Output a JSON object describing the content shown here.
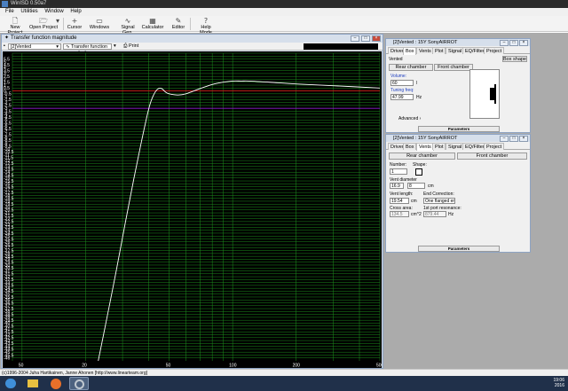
{
  "app": {
    "title": "WinISD 0.50a7"
  },
  "menu": [
    "File",
    "Utilities",
    "Window",
    "Help"
  ],
  "toolbar": {
    "new_project": "New Project",
    "open_project": "Open Project",
    "cursor": "Cursor",
    "windows": "Windows",
    "signal_gen": "Signal Gen.",
    "calculator": "Calculator",
    "editor": "Editor",
    "help_mode": "Help Mode"
  },
  "graph_window": {
    "title": "Transfer function magnitude",
    "project_select": "[2]Vented",
    "graph_select": "Transfer function magnitude",
    "print": "Print"
  },
  "chart_data": {
    "type": "line",
    "xscale": "log",
    "xlim": [
      9,
      500
    ],
    "ylim": [
      -46.5,
      6.5
    ],
    "x_ticks": [
      10,
      20,
      50,
      100,
      200,
      500
    ],
    "x_tick_labels": [
      "50",
      "20",
      "50",
      "100",
      "200",
      "500"
    ],
    "y_ticks": [
      6.5,
      6,
      5.5,
      5,
      4.5,
      4,
      3.5,
      3,
      2.5,
      2,
      1.5,
      1,
      0.5,
      0,
      -0.5,
      -1,
      -1.5,
      -2,
      -2.5,
      -3,
      -3.5,
      -4,
      -4.5,
      -5,
      -5.5,
      -6,
      -6.5,
      -7,
      -7.5,
      -8,
      -8.5,
      -9,
      -9.5,
      -10,
      -10.5,
      -11,
      -11.5,
      -12,
      -12.5,
      -13,
      -13.5,
      -14,
      -14.5,
      -15,
      -15.5,
      -16,
      -16.5,
      -17,
      -17.5,
      -18,
      -18.5,
      -19,
      -19.5,
      -20,
      -20.5,
      -21,
      -21.5,
      -22,
      -22.5,
      -23,
      -23.5,
      -24,
      -24.5,
      -25,
      -25.5,
      -26,
      -26.5,
      -27,
      -27.5,
      -28,
      -28.5,
      -29,
      -29.5,
      -30,
      -30.5,
      -31,
      -31.5,
      -32,
      -32.5,
      -33,
      -33.5,
      -34,
      -34.5,
      -35,
      -35.5,
      -36,
      -36.5,
      -37,
      -37.5,
      -38,
      -38.5,
      -39,
      -39.5,
      -40,
      -40.5,
      -41,
      -41.5,
      -42,
      -42.5,
      -43,
      -43.5,
      -44,
      -44.5,
      -45,
      -45.5,
      -46
    ],
    "y_tick_labels": [
      "5.5",
      "5",
      "4.5",
      "4",
      "3.5",
      "3",
      "2.5",
      "2",
      "1.5",
      "1",
      "0.5",
      "0",
      "-0.5",
      "-1",
      "-1.5",
      "-2",
      "-2.5",
      "-3",
      "-3.5",
      "-4",
      "-4.5",
      "-5",
      "-5.5",
      "-6",
      "-6.5",
      "-7",
      "-7.5",
      "-8",
      "-8.5",
      "-9",
      "-9.5",
      "-10",
      "-10.5",
      "-11",
      "-11.5",
      "-12",
      "-12.5",
      "-13",
      "-13.5",
      "-14",
      "-14.5",
      "-15",
      "-15.5",
      "-16",
      "-16.5",
      "-17",
      "-17.5",
      "-18",
      "-18.5",
      "-19",
      "-19.5",
      "-20",
      "-20.5",
      "-21",
      "-21.5",
      "-22",
      "-22.5",
      "-23",
      "-23.5",
      "-24",
      "-24.5",
      "-25",
      "-25.5",
      "-26",
      "-26.5",
      "-27",
      "-27.5",
      "-28",
      "-28.5",
      "-29",
      "-29.5",
      "-30",
      "-30.5",
      "-31",
      "-31.5",
      "-32",
      "-32.5",
      "-33",
      "-33.5",
      "-34",
      "-34.5",
      "-35",
      "-35.5",
      "-36",
      "-36.5",
      "-37",
      "-37.5",
      "-38",
      "-38.5",
      "-39",
      "-39.5",
      "-40",
      "-40.5",
      "-41",
      "-41.5",
      "-42",
      "-42.5",
      "-43",
      "-43.5",
      "-44",
      "-44.5",
      "-45",
      "-45.5",
      "-46"
    ],
    "reference_lines": [
      {
        "y": 0,
        "color": "#d01818"
      },
      {
        "y": -3,
        "color": "#8c1cd0"
      }
    ],
    "series": [
      {
        "color": "#ffffff",
        "x": [
          23,
          25,
          28,
          31,
          34,
          37,
          40,
          42,
          44,
          46,
          48,
          50,
          55,
          60,
          70,
          80,
          90,
          100,
          110,
          120,
          150,
          200,
          300,
          500
        ],
        "y": [
          -46.5,
          -40,
          -31,
          -22.5,
          -15,
          -8.5,
          -3,
          -0.8,
          0.3,
          0.4,
          -0.2,
          -0.5,
          -0.7,
          -0.5,
          0.4,
          1.1,
          1.5,
          1.7,
          1.7,
          1.7,
          1.5,
          1.2,
          0.9,
          0.5
        ]
      }
    ],
    "grid": true,
    "line_color": "#ffffff",
    "grid_color": "#1e8f1e",
    "background": "#000000"
  },
  "box_window": {
    "title": "[2]Vented : 15Y SonyAIRROT",
    "tabs": [
      "Driver",
      "Box",
      "Vents",
      "Plot",
      "Signal",
      "EQ/Filter",
      "Project"
    ],
    "active_tab": "Box",
    "box_type": "Vented",
    "box_shape_button": "Box shape",
    "rear_chamber_button": "Rear chamber",
    "front_chamber_button": "Front chamber",
    "volume_label": "Volume:",
    "volume_value": "60",
    "volume_unit": "l",
    "tuning_label": "Tuning freq:",
    "tuning_value": "47.99",
    "tuning_unit": "Hz",
    "advanced": "Advanced ›",
    "parameters": "Parameters"
  },
  "vents_window": {
    "title": "[2]Vented : 15Y SonyAIRROT",
    "tabs": [
      "Driver",
      "Box",
      "Vents",
      "Plot",
      "Signal",
      "EQ/Filter",
      "Project"
    ],
    "active_tab": "Vents",
    "rear_chamber_button": "Rear chamber",
    "front_chamber_button": "Front chamber",
    "number_label": "Number:",
    "number_value": "1",
    "shape_label": "Shape:",
    "diameter_label": "Vent diameter",
    "diameter_value": "16.9",
    "diameter_frac": "8",
    "diameter_unit": "cm",
    "length_label": "Vent length:",
    "length_value": "19.54",
    "length_unit": "cm",
    "end_correction_label": "End Correction:",
    "end_correction_value": "One flanged en",
    "cross_area_label": "Cross area:",
    "cross_area_value": "134.5",
    "cross_area_unit": "cm^2",
    "resonance_label": "1st port resonance:",
    "resonance_value": "879.44",
    "resonance_unit": "Hz",
    "parameters": "Parameters"
  },
  "status": "(c)1996-2004 Juha Hartikainen, Janne Ahonen [http://www.linearteam.org]",
  "taskbar": {
    "time": "19:06",
    "date": "2016"
  }
}
